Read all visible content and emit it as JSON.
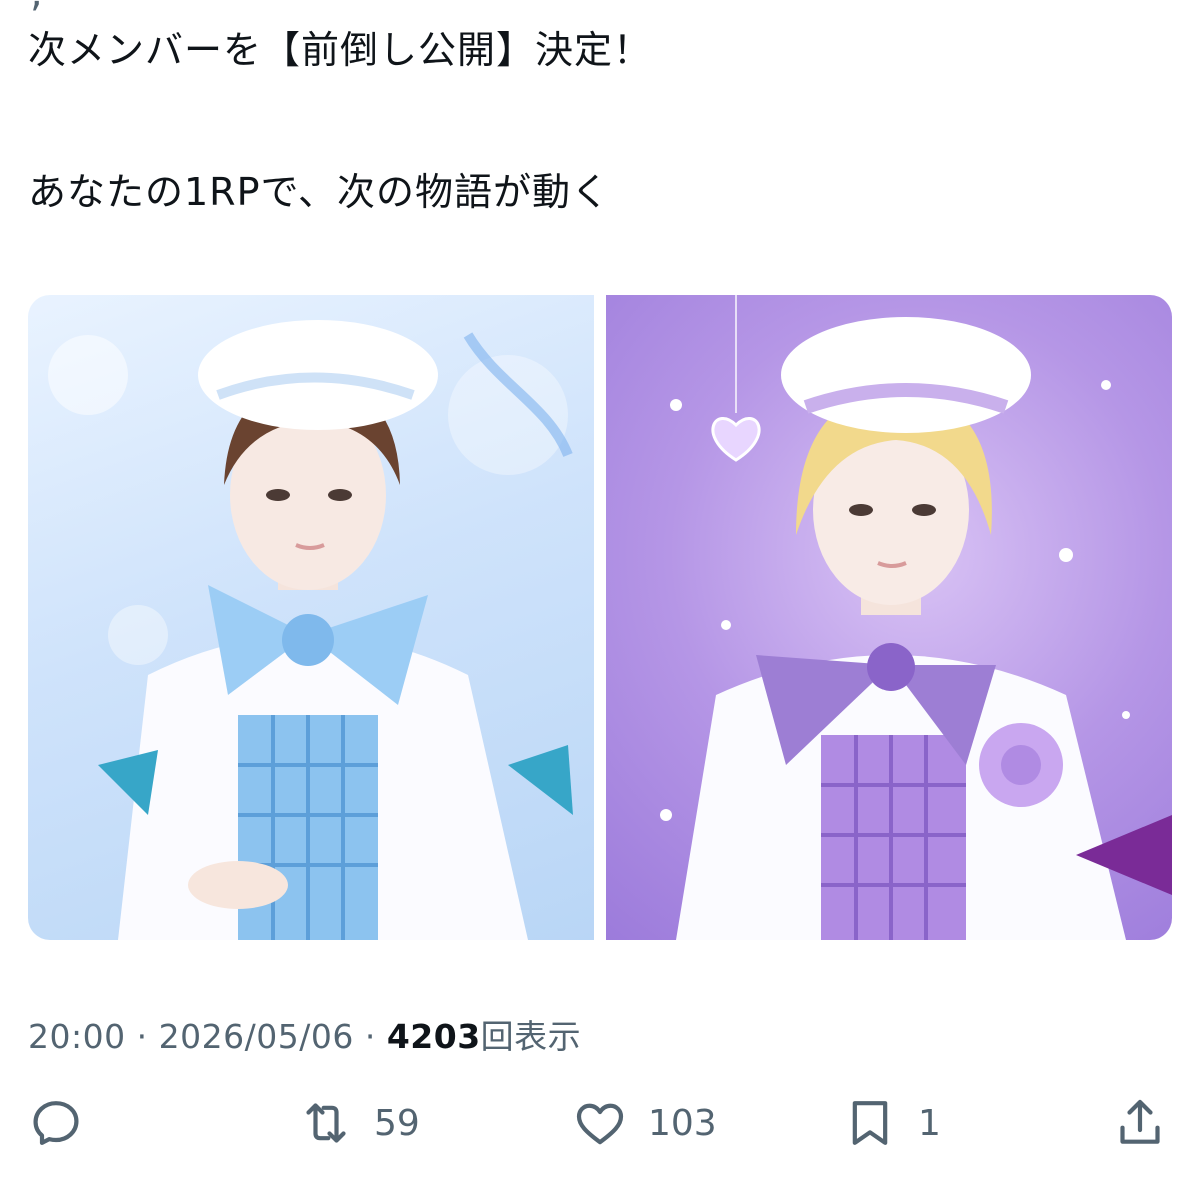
{
  "tweet": {
    "line1": "次メンバーを【前倒し公開】決定！",
    "line2": "あなたの1RPで、次の物語が動く"
  },
  "media": {
    "left_theme_color": "#bcd8f7",
    "right_theme_color": "#b596e6"
  },
  "meta": {
    "time": "20:00",
    "separator": "·",
    "date": "2026/05/06",
    "views_count": "4203",
    "views_label": "回表示"
  },
  "actions": {
    "reply_count": "",
    "retweet_count": "59",
    "like_count": "103",
    "bookmark_count": "1"
  },
  "icons": [
    "reply-icon",
    "retweet-icon",
    "like-icon",
    "bookmark-icon",
    "share-icon"
  ]
}
